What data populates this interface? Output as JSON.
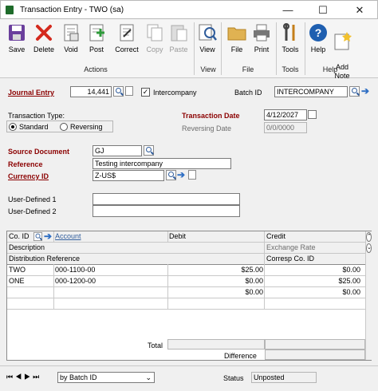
{
  "window": {
    "title": "Transaction Entry  -  TWO (sa)",
    "minimize": "—",
    "maximize": "☐",
    "close": "✕"
  },
  "ribbon": {
    "buttons": [
      {
        "label": "Save",
        "icon": "save-icon"
      },
      {
        "label": "Delete",
        "icon": "delete-icon"
      },
      {
        "label": "Void",
        "icon": "void-icon"
      },
      {
        "label": "Post",
        "icon": "post-icon"
      },
      {
        "label": "Correct",
        "icon": "correct-icon"
      },
      {
        "label": "Copy",
        "icon": "copy-icon"
      },
      {
        "label": "Paste",
        "icon": "paste-icon"
      },
      {
        "label": "View",
        "icon": "view-icon"
      },
      {
        "label": "File",
        "icon": "file-icon"
      },
      {
        "label": "Print",
        "icon": "print-icon"
      },
      {
        "label": "Tools",
        "icon": "tools-icon"
      },
      {
        "label": "Help",
        "icon": "help-icon"
      },
      {
        "label": "Add\nNote",
        "icon": "add-note-icon"
      }
    ],
    "groups": [
      "Actions",
      "View",
      "File",
      "Tools",
      "Help"
    ]
  },
  "header": {
    "journal_entry_label": "Journal Entry",
    "journal_entry_value": "14,441",
    "intercompany_label": "Intercompany",
    "intercompany_checked": true,
    "batch_id_label": "Batch ID",
    "batch_id_value": "INTERCOMPANY",
    "transaction_type_label": "Transaction Type:",
    "type_standard": "Standard",
    "type_reversing": "Reversing",
    "transaction_date_label": "Transaction Date",
    "transaction_date_value": "4/12/2027",
    "reversing_date_label": "Reversing Date",
    "reversing_date_value": "0/0/0000",
    "source_document_label": "Source Document",
    "source_document_value": "GJ",
    "reference_label": "Reference",
    "reference_value": "Testing intercompany",
    "currency_id_label": "Currency ID",
    "currency_id_value": "Z-US$",
    "user_defined_1_label": "User-Defined 1",
    "user_defined_2_label": "User-Defined 2"
  },
  "grid": {
    "columns": {
      "co_id": "Co. ID",
      "account": "Account",
      "debit": "Debit",
      "credit": "Credit",
      "description": "Description",
      "exchange_rate": "Exchange Rate",
      "distribution_reference": "Distribution Reference",
      "corresp_co_id": "Corresp Co. ID"
    },
    "rows": [
      {
        "co_id": "TWO",
        "account": "000-1100-00",
        "debit": "$25.00",
        "credit": "$0.00"
      },
      {
        "co_id": "ONE",
        "account": "000-1200-00",
        "debit": "$0.00",
        "credit": "$25.00"
      },
      {
        "co_id": "",
        "account": "",
        "debit": "$0.00",
        "credit": "$0.00"
      }
    ],
    "total_label": "Total",
    "difference_label": "Difference"
  },
  "statusbar": {
    "sort_value": "by Batch ID",
    "status_label": "Status",
    "status_value": "Unposted"
  }
}
